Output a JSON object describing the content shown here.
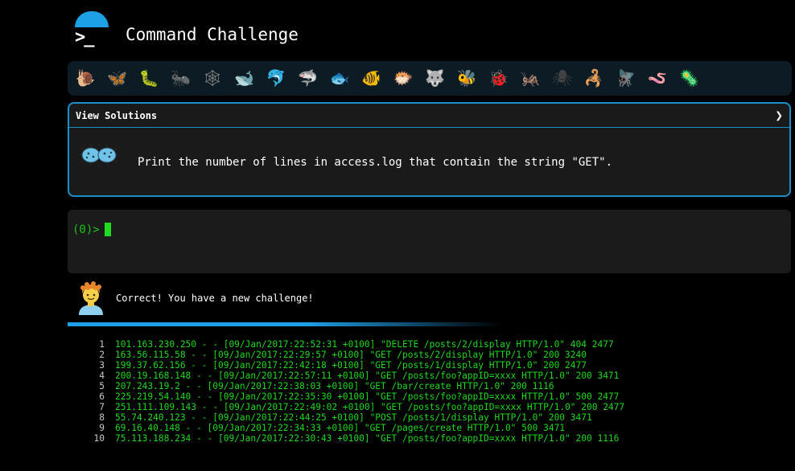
{
  "app": {
    "title": "Command Challenge"
  },
  "critters": [
    {
      "icon": "snail-icon",
      "glyph": "🐌",
      "color": "#b08a50"
    },
    {
      "icon": "butterfly-icon",
      "glyph": "🦋",
      "color": "#e07a1a"
    },
    {
      "icon": "caterpillar-icon",
      "glyph": "🐛",
      "color": "#7cc243"
    },
    {
      "icon": "ant-icon",
      "glyph": "🐜",
      "color": "#555555"
    },
    {
      "icon": "spider-web-icon",
      "glyph": "🕸",
      "color": "#888888"
    },
    {
      "icon": "whale-icon",
      "glyph": "🐋",
      "color": "#7fb0d8"
    },
    {
      "icon": "dolphin-icon",
      "glyph": "🐬",
      "color": "#6fb0e0"
    },
    {
      "icon": "shark-icon",
      "glyph": "🦈",
      "color": "#8aa0b0"
    },
    {
      "icon": "fish-icon",
      "glyph": "🐟",
      "color": "#5fa8e6"
    },
    {
      "icon": "tropical-fish-icon",
      "glyph": "🐠",
      "color": "#f2c300"
    },
    {
      "icon": "blowfish-icon",
      "glyph": "🐡",
      "color": "#b07840"
    },
    {
      "icon": "wolf-icon",
      "glyph": "🐺",
      "color": "#9aa0a6"
    },
    {
      "icon": "bee-icon",
      "glyph": "🐝",
      "color": "#f2c300"
    },
    {
      "icon": "ladybug-icon",
      "glyph": "🐞",
      "color": "#e53935"
    },
    {
      "icon": "cricket-icon",
      "glyph": "🦗",
      "color": "#7cc243"
    },
    {
      "icon": "spider-icon",
      "glyph": "🕷",
      "color": "#444444"
    },
    {
      "icon": "scorpion-icon",
      "glyph": "🦂",
      "color": "#c0392b"
    },
    {
      "icon": "fly-icon",
      "glyph": "🪰",
      "color": "#8fa3b0"
    },
    {
      "icon": "worm-icon",
      "glyph": "🪱",
      "color": "#e08aa0"
    },
    {
      "icon": "microbe-icon",
      "glyph": "🦠",
      "color": "#6fc3e8"
    }
  ],
  "challenge": {
    "view_solutions": "View Solutions",
    "chevron": "❯",
    "task": "Print the number of lines in access.log that contain the string \"GET\"."
  },
  "terminal": {
    "prompt": "(0)>"
  },
  "feedback": {
    "message": "Correct! You have a new challenge!"
  },
  "log_lines": [
    {
      "n": "1",
      "text": "101.163.230.250 - - [09/Jan/2017:22:52:31 +0100] \"DELETE /posts/2/display HTTP/1.0\" 404 2477"
    },
    {
      "n": "2",
      "text": "163.56.115.58 - - [09/Jan/2017:22:29:57 +0100] \"GET /posts/2/display HTTP/1.0\" 200 3240"
    },
    {
      "n": "3",
      "text": "199.37.62.156 - - [09/Jan/2017:22:42:18 +0100] \"GET /posts/1/display HTTP/1.0\" 200 2477"
    },
    {
      "n": "4",
      "text": "200.19.168.148 - - [09/Jan/2017:22:57:11 +0100] \"GET /posts/foo?appID=xxxx HTTP/1.0\" 200 3471"
    },
    {
      "n": "5",
      "text": "207.243.19.2 - - [09/Jan/2017:22:38:03 +0100] \"GET /bar/create HTTP/1.0\" 200 1116"
    },
    {
      "n": "6",
      "text": "225.219.54.140 - - [09/Jan/2017:22:35:30 +0100] \"GET /posts/foo?appID=xxxx HTTP/1.0\" 500 2477"
    },
    {
      "n": "7",
      "text": "251.111.109.143 - - [09/Jan/2017:22:49:02 +0100] \"GET /posts/foo?appID=xxxx HTTP/1.0\" 200 2477"
    },
    {
      "n": "8",
      "text": "55.74.240.123 - - [09/Jan/2017:22:44:25 +0100] \"POST /posts/1/display HTTP/1.0\" 200 3471"
    },
    {
      "n": "9",
      "text": "69.16.40.148 - - [09/Jan/2017:22:34:33 +0100] \"GET /pages/create HTTP/1.0\" 500 3471"
    },
    {
      "n": "10",
      "text": "75.113.188.234 - - [09/Jan/2017:22:30:43 +0100] \"GET /posts/foo?appID=xxxx HTTP/1.0\" 200 1116"
    }
  ],
  "colors": {
    "accent": "#1ea0e6",
    "terminal_green": "#1fd81f"
  }
}
